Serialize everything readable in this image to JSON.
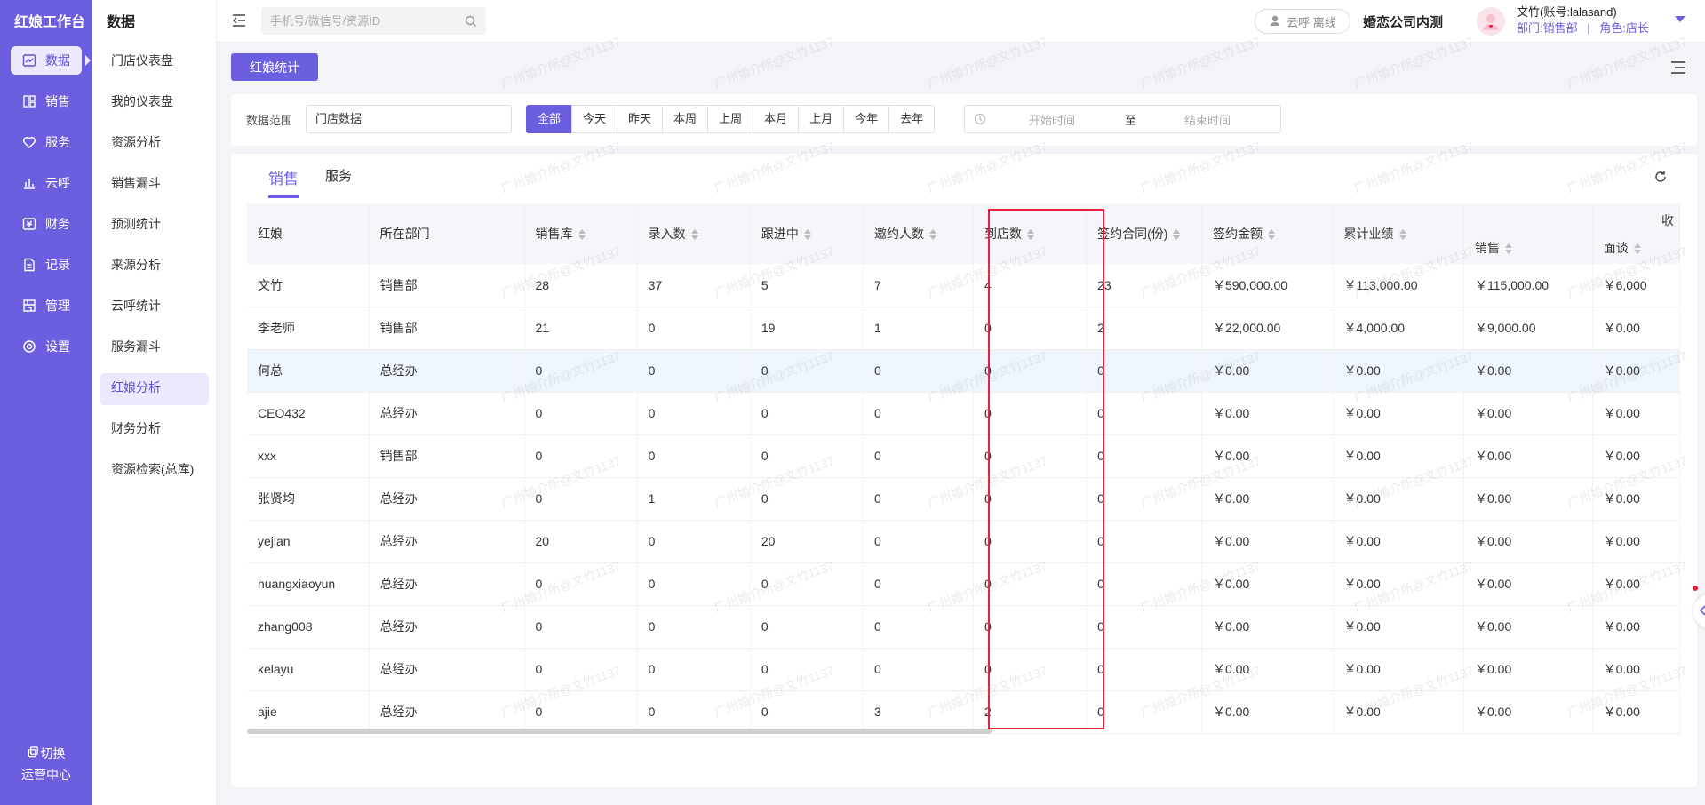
{
  "sidebar": {
    "brand": "红娘工作台",
    "items": [
      {
        "label": "数据",
        "icon": "chart-icon",
        "active": true
      },
      {
        "label": "销售",
        "icon": "grid-icon"
      },
      {
        "label": "服务",
        "icon": "heart-icon"
      },
      {
        "label": "云呼",
        "icon": "bar-chart-icon"
      },
      {
        "label": "财务",
        "icon": "wallet-icon"
      },
      {
        "label": "记录",
        "icon": "file-icon"
      },
      {
        "label": "管理",
        "icon": "building-icon"
      },
      {
        "label": "设置",
        "icon": "gear-icon"
      }
    ],
    "switch_label": "切换",
    "switch_sub": "运营中心"
  },
  "submenu": {
    "title": "数据",
    "items": [
      {
        "label": "门店仪表盘"
      },
      {
        "label": "我的仪表盘"
      },
      {
        "label": "资源分析"
      },
      {
        "label": "销售漏斗"
      },
      {
        "label": "预测统计"
      },
      {
        "label": "来源分析"
      },
      {
        "label": "云呼统计"
      },
      {
        "label": "服务漏斗"
      },
      {
        "label": "红娘分析",
        "active": true
      },
      {
        "label": "财务分析"
      },
      {
        "label": "资源检索(总库)"
      }
    ]
  },
  "topbar": {
    "search_placeholder": "手机号/微信号/资源ID",
    "cloud_status": "云呼 离线",
    "company": "婚恋公司内测",
    "user_name": "文竹(账号:lalasand)",
    "user_dept": "部门:销售部",
    "user_sep": "|",
    "user_role": "角色:店长"
  },
  "main": {
    "tag_label": "红娘统计",
    "filter": {
      "label": "数据范围",
      "scope": "门店数据",
      "ranges": [
        "全部",
        "今天",
        "昨天",
        "本周",
        "上周",
        "本月",
        "上月",
        "今年",
        "去年"
      ],
      "active_range": "全部",
      "start_placeholder": "开始时间",
      "to": "至",
      "end_placeholder": "结束时间"
    },
    "tabs": [
      {
        "label": "销售",
        "active": true
      },
      {
        "label": "服务"
      }
    ]
  },
  "table": {
    "columns": [
      "红娘",
      "所在部门",
      "销售库",
      "录入数",
      "跟进中",
      "邀约人数",
      "到店数",
      "签约合同(份)",
      "签约金额",
      "累计业绩",
      "销售",
      "面谈"
    ],
    "group_label": "收",
    "rows": [
      [
        "文竹",
        "销售部",
        "28",
        "37",
        "5",
        "7",
        "4",
        "23",
        "￥590,000.00",
        "￥113,000.00",
        "￥115,000.00",
        "￥6,000"
      ],
      [
        "李老师",
        "销售部",
        "21",
        "0",
        "19",
        "1",
        "0",
        "2",
        "￥22,000.00",
        "￥4,000.00",
        "￥9,000.00",
        "￥0.00"
      ],
      [
        "何总",
        "总经办",
        "0",
        "0",
        "0",
        "0",
        "0",
        "0",
        "￥0.00",
        "￥0.00",
        "￥0.00",
        "￥0.00"
      ],
      [
        "CEO432",
        "总经办",
        "0",
        "0",
        "0",
        "0",
        "0",
        "0",
        "￥0.00",
        "￥0.00",
        "￥0.00",
        "￥0.00"
      ],
      [
        "xxx",
        "销售部",
        "0",
        "0",
        "0",
        "0",
        "0",
        "0",
        "￥0.00",
        "￥0.00",
        "￥0.00",
        "￥0.00"
      ],
      [
        "张贤均",
        "总经办",
        "0",
        "1",
        "0",
        "0",
        "0",
        "0",
        "￥0.00",
        "￥0.00",
        "￥0.00",
        "￥0.00"
      ],
      [
        "yejian",
        "总经办",
        "20",
        "0",
        "20",
        "0",
        "0",
        "0",
        "￥0.00",
        "￥0.00",
        "￥0.00",
        "￥0.00"
      ],
      [
        "huangxiaoyun",
        "总经办",
        "0",
        "0",
        "0",
        "0",
        "0",
        "0",
        "￥0.00",
        "￥0.00",
        "￥0.00",
        "￥0.00"
      ],
      [
        "zhang008",
        "总经办",
        "0",
        "0",
        "0",
        "0",
        "0",
        "0",
        "￥0.00",
        "￥0.00",
        "￥0.00",
        "￥0.00"
      ],
      [
        "kelayu",
        "总经办",
        "0",
        "0",
        "0",
        "0",
        "0",
        "0",
        "￥0.00",
        "￥0.00",
        "￥0.00",
        "￥0.00"
      ],
      [
        "ajie",
        "总经办",
        "0",
        "0",
        "0",
        "3",
        "2",
        "0",
        "￥0.00",
        "￥0.00",
        "￥0.00",
        "￥0.00"
      ]
    ],
    "highlight_row": 2
  },
  "watermark": "广州婚介所@文竹1137",
  "colors": {
    "accent": "#6b5fe0",
    "highlight_box": "#e8213a"
  }
}
